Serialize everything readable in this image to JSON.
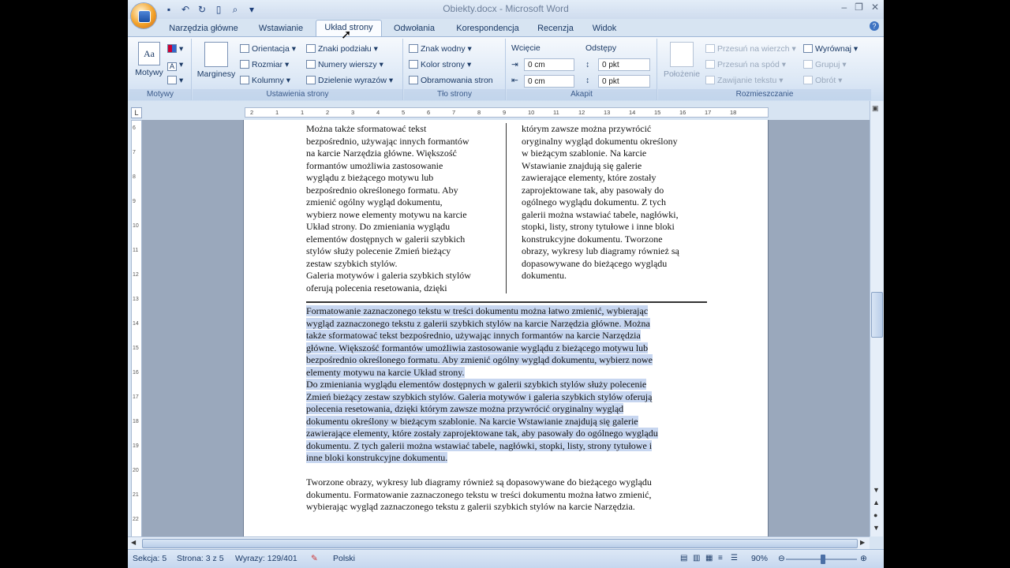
{
  "window": {
    "title": "Obiekty.docx - Microsoft Word",
    "minimize": "–",
    "restore": "❐",
    "close": "✕"
  },
  "qat": [
    "save-icon",
    "undo-icon",
    "redo-icon",
    "new-doc-icon",
    "print-preview-icon",
    "customize-icon"
  ],
  "tabs": [
    {
      "label": "Narzędzia główne"
    },
    {
      "label": "Wstawianie"
    },
    {
      "label": "Układ strony"
    },
    {
      "label": "Odwołania"
    },
    {
      "label": "Korespondencja"
    },
    {
      "label": "Recenzja"
    },
    {
      "label": "Widok"
    }
  ],
  "active_tab": "Układ strony",
  "ribbon": {
    "motywy": {
      "button": "Motywy",
      "group": "Motywy"
    },
    "ustawienia": {
      "marginesy": "Marginesy",
      "orientacja": "Orientacja",
      "rozmiar": "Rozmiar",
      "kolumny": "Kolumny",
      "znaki": "Znaki podziału",
      "numery": "Numery wierszy",
      "dzielenie": "Dzielenie wyrazów",
      "group": "Ustawienia strony"
    },
    "tlo": {
      "znak": "Znak wodny",
      "kolor": "Kolor strony",
      "obramowania": "Obramowania stron",
      "group": "Tło strony"
    },
    "akapit": {
      "wciecie": "Wcięcie",
      "odstepy": "Odstępy",
      "left": "0 cm",
      "right": "0 cm",
      "before": "0 pkt",
      "after": "0 pkt",
      "group": "Akapit"
    },
    "rozmieszczanie": {
      "polozenie": "Położenie",
      "przesun_wierzch": "Przesuń na wierzch",
      "przesun_spod": "Przesuń na spód",
      "zawijanie": "Zawijanie tekstu",
      "wyrownaj": "Wyrównaj",
      "grupuj": "Grupuj",
      "obrot": "Obrót",
      "group": "Rozmieszczanie"
    }
  },
  "ruler_ticks": [
    "2",
    "1",
    "1",
    "2",
    "3",
    "4",
    "5",
    "6",
    "7",
    "8",
    "9",
    "10",
    "11",
    "12",
    "13",
    "14",
    "15",
    "16",
    "17",
    "18"
  ],
  "vruler_ticks": [
    "6",
    "7",
    "8",
    "9",
    "10",
    "11",
    "12",
    "13",
    "14",
    "15",
    "16",
    "17",
    "18",
    "19",
    "20",
    "21",
    "22"
  ],
  "document": {
    "col_left": [
      "Można także sformatować tekst",
      "bezpośrednio, używając innych formantów",
      "na karcie Narzędzia główne. Większość",
      "formantów umożliwia zastosowanie",
      "wyglądu z bieżącego motywu lub",
      "bezpośrednio określonego formatu. Aby",
      "zmienić ogólny wygląd dokumentu,",
      "wybierz nowe elementy motywu na karcie",
      "Układ strony. Do zmieniania wyglądu",
      "elementów dostępnych w galerii szybkich",
      "stylów służy polecenie Zmień bieżący",
      "zestaw szybkich stylów.",
      "Galeria motywów i galeria szybkich stylów",
      "oferują polecenia resetowania, dzięki"
    ],
    "col_right": [
      "którym zawsze można przywrócić",
      "oryginalny wygląd dokumentu określony",
      "w bieżącym szablonie. Na karcie",
      "Wstawianie znajdują się galerie",
      "zawierające elementy, które zostały",
      "zaprojektowane tak, aby pasowały do",
      "ogólnego wyglądu dokumentu. Z tych",
      "galerii można wstawiać tabele, nagłówki,",
      "stopki, listy, strony tytułowe i inne bloki",
      "konstrukcyjne dokumentu. Tworzone",
      "obrazy, wykresy lub diagramy również są",
      "dopasowywane do bieżącego wyglądu",
      "dokumentu."
    ],
    "selected": [
      "Formatowanie zaznaczonego tekstu w treści dokumentu można łatwo zmienić, wybierając",
      "wygląd zaznaczonego tekstu z galerii szybkich stylów na karcie Narzędzia główne. Można",
      "także sformatować tekst bezpośrednio, używając innych formantów na karcie Narzędzia",
      "główne. Większość formantów umożliwia zastosowanie wyglądu z bieżącego motywu lub",
      "bezpośrednio określonego formatu. Aby zmienić ogólny wygląd dokumentu, wybierz nowe",
      "elementy motywu na karcie Układ strony.",
      "Do zmieniania wyglądu elementów dostępnych w galerii szybkich stylów służy polecenie",
      "Zmień bieżący zestaw szybkich stylów. Galeria motywów i galeria szybkich stylów oferują",
      "polecenia resetowania, dzięki którym zawsze można przywrócić oryginalny wygląd",
      "dokumentu określony w bieżącym szablonie. Na karcie Wstawianie znajdują się galerie",
      "zawierające elementy, które zostały zaprojektowane tak, aby pasowały do ogólnego wyglądu",
      "dokumentu. Z tych galerii można wstawiać tabele, nagłówki, stopki, listy, strony tytułowe i",
      "inne bloki konstrukcyjne dokumentu."
    ],
    "after": [
      "Tworzone obrazy, wykresy lub diagramy również są dopasowywane do bieżącego wyglądu",
      "dokumentu. Formatowanie zaznaczonego tekstu w treści dokumentu można łatwo zmienić,",
      "wybierając wygląd zaznaczonego tekstu z galerii szybkich stylów na karcie Narzędzia."
    ]
  },
  "status": {
    "sekcja": "Sekcja: 5",
    "strona": "Strona: 3 z 5",
    "wyrazy": "Wyrazy: 129/401",
    "jezyk": "Polski",
    "zoom": "90%"
  },
  "colors": {
    "selection": "#c7d6f0",
    "ribbon": "#dbe7f5",
    "accent": "#1b3a66"
  }
}
